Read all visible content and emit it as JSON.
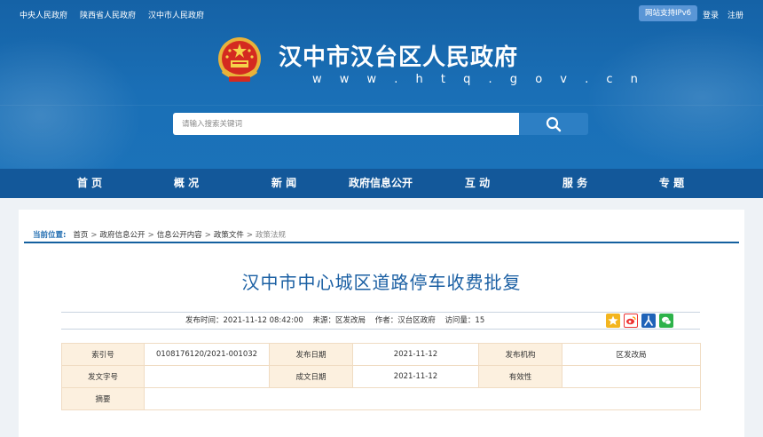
{
  "top_links": [
    "中央人民政府",
    "陕西省人民政府",
    "汉中市人民政府"
  ],
  "ipv6_label": "网站支持IPv6",
  "auth": {
    "login": "登录",
    "register": "注册"
  },
  "site": {
    "title": "汉中市汉台区人民政府",
    "url": "w w w . h t q . g o v . c n"
  },
  "search": {
    "placeholder": "请输入搜索关键词"
  },
  "nav": [
    "首 页",
    "概 况",
    "新 闻",
    "政府信息公开",
    "互 动",
    "服 务",
    "专 题"
  ],
  "breadcrumb": {
    "label": "当前位置:",
    "items": [
      "首页",
      "政府信息公开",
      "信息公开内容",
      "政策文件"
    ],
    "current": "政策法规"
  },
  "article": {
    "title": "汉中市中心城区道路停车收费批复",
    "publish_time": "发布时间：2021-11-12 08:42:00",
    "source": "来源：区发改局",
    "author": "作者：汉台区政府",
    "views": "访问量：15"
  },
  "info_table": {
    "rows": [
      [
        "索引号",
        "0108176120/2021-001032",
        "发布日期",
        "2021-11-12",
        "发布机构",
        "区发改局"
      ],
      [
        "发文字号",
        "",
        "成文日期",
        "2021-11-12",
        "有效性",
        ""
      ],
      [
        "摘要",
        ""
      ]
    ]
  },
  "colors": {
    "header": "#1a6fb6",
    "nav": "#13589a",
    "title": "#1a5fa3",
    "table_key_bg": "#fcf0df"
  },
  "icons": [
    "search-icon",
    "qzone-icon",
    "weibo-icon",
    "renren-icon",
    "wechat-icon"
  ]
}
